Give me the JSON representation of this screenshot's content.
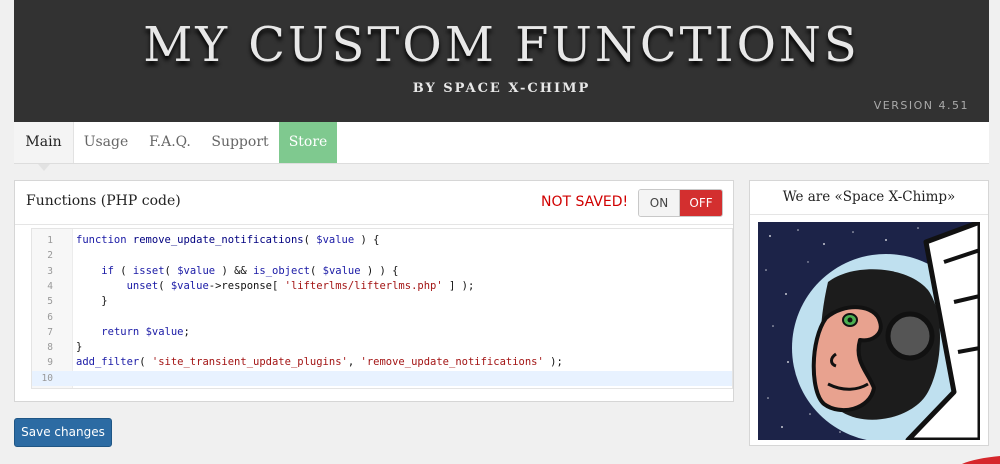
{
  "header": {
    "title": "MY CUSTOM FUNCTIONS",
    "subtitle": "BY SPACE X-CHIMP",
    "version": "VERSION 4.51"
  },
  "tabs": [
    {
      "label": "Main",
      "active": true
    },
    {
      "label": "Usage"
    },
    {
      "label": "F.A.Q."
    },
    {
      "label": "Support"
    },
    {
      "label": "Store"
    }
  ],
  "panel": {
    "title": "Functions (PHP code)",
    "status": "NOT SAVED!",
    "toggle_on": "ON",
    "toggle_off": "OFF",
    "toggle_state": "OFF"
  },
  "code": {
    "lines": [
      {
        "n": "1",
        "text": "function remove_update_notifications( $value ) {"
      },
      {
        "n": "2",
        "text": ""
      },
      {
        "n": "3",
        "text": "    if ( isset( $value ) && is_object( $value ) ) {"
      },
      {
        "n": "4",
        "text": "        unset( $value->response[ 'lifterlms/lifterlms.php' ] );"
      },
      {
        "n": "5",
        "text": "    }"
      },
      {
        "n": "6",
        "text": ""
      },
      {
        "n": "7",
        "text": "    return $value;"
      },
      {
        "n": "8",
        "text": "}"
      },
      {
        "n": "9",
        "text": "add_filter( 'site_transient_update_plugins', 'remove_update_notifications' );"
      },
      {
        "n": "10",
        "text": ""
      }
    ],
    "active_line": 10
  },
  "buttons": {
    "save": "Save changes"
  },
  "sidebar": {
    "title": "We are «Space X-Chimp»"
  },
  "colors": {
    "header_bg": "#323232",
    "store_tab": "#7fc98f",
    "off_button": "#d32f2f",
    "not_saved": "#d00000",
    "save_button": "#2c6ba3"
  }
}
